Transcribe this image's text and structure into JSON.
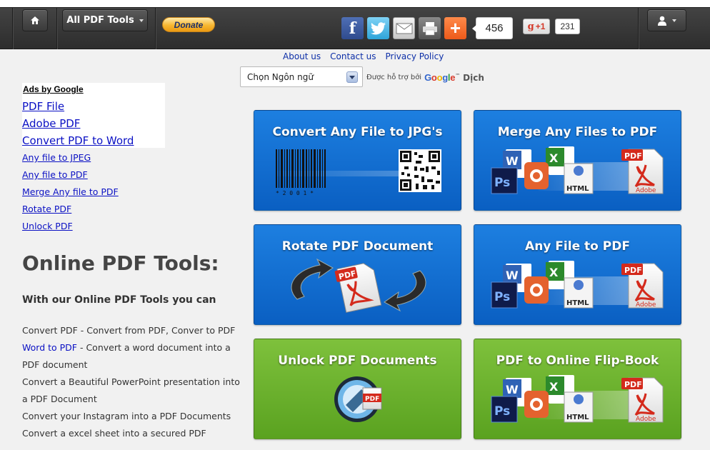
{
  "nav": {
    "home_icon": "home-icon",
    "all_tools_label": "All PDF Tools",
    "donate_label": "Donate",
    "share_count": "456",
    "gplus_label": "+1",
    "gplus_count": "231",
    "user_icon": "user-icon"
  },
  "links": {
    "about": "About us",
    "contact": "Contact us",
    "privacy": "Privacy Policy"
  },
  "translate": {
    "selected": "Chọn Ngôn ngữ",
    "powered_by": "Được hỗ trợ bởi",
    "google": "Google",
    "tm": "™",
    "dich": "Dịch"
  },
  "ads": {
    "label": "Ads by Google",
    "items": [
      "PDF File",
      "Adobe PDF",
      "Convert PDF to Word"
    ]
  },
  "sidebar_links": [
    "Any file to JPEG",
    "Any file to PDF",
    "Merge Any file to PDF",
    "Rotate PDF",
    "Unlock PDF"
  ],
  "content": {
    "heading": "Online PDF Tools:",
    "subheading": "With our Online PDF Tools you can",
    "desc1": "Convert PDF - Convert from PDF, Conver to PDF",
    "desc2_link": "Word to PDF",
    "desc2_rest": " - Convert a word document into a PDF document",
    "desc3": "Convert a Beautiful PowerPoint presentation into a PDF Document",
    "desc4": "Convert your Instagram into a PDF Documents",
    "desc5": "Convert a excel sheet into a secured PDF"
  },
  "tiles": [
    {
      "title": "Convert Any File to JPG's",
      "color": "#0d68cc"
    },
    {
      "title": "Merge Any Files to PDF",
      "color": "#0d68cc"
    },
    {
      "title": "Rotate PDF Document",
      "color": "#0d68cc"
    },
    {
      "title": "Any File to PDF",
      "color": "#0d68cc"
    },
    {
      "title": "Unlock PDF Documents",
      "color": "#6cb22e"
    },
    {
      "title": "PDF to Online Flip-Book",
      "color": "#6cb22e"
    }
  ],
  "art": {
    "barcode_digits": "* 2 0 0 1 *",
    "ps": "Ps",
    "w": "W",
    "x": "X",
    "html": "HTML",
    "pdf": "PDF",
    "adobe": "Adobe"
  }
}
